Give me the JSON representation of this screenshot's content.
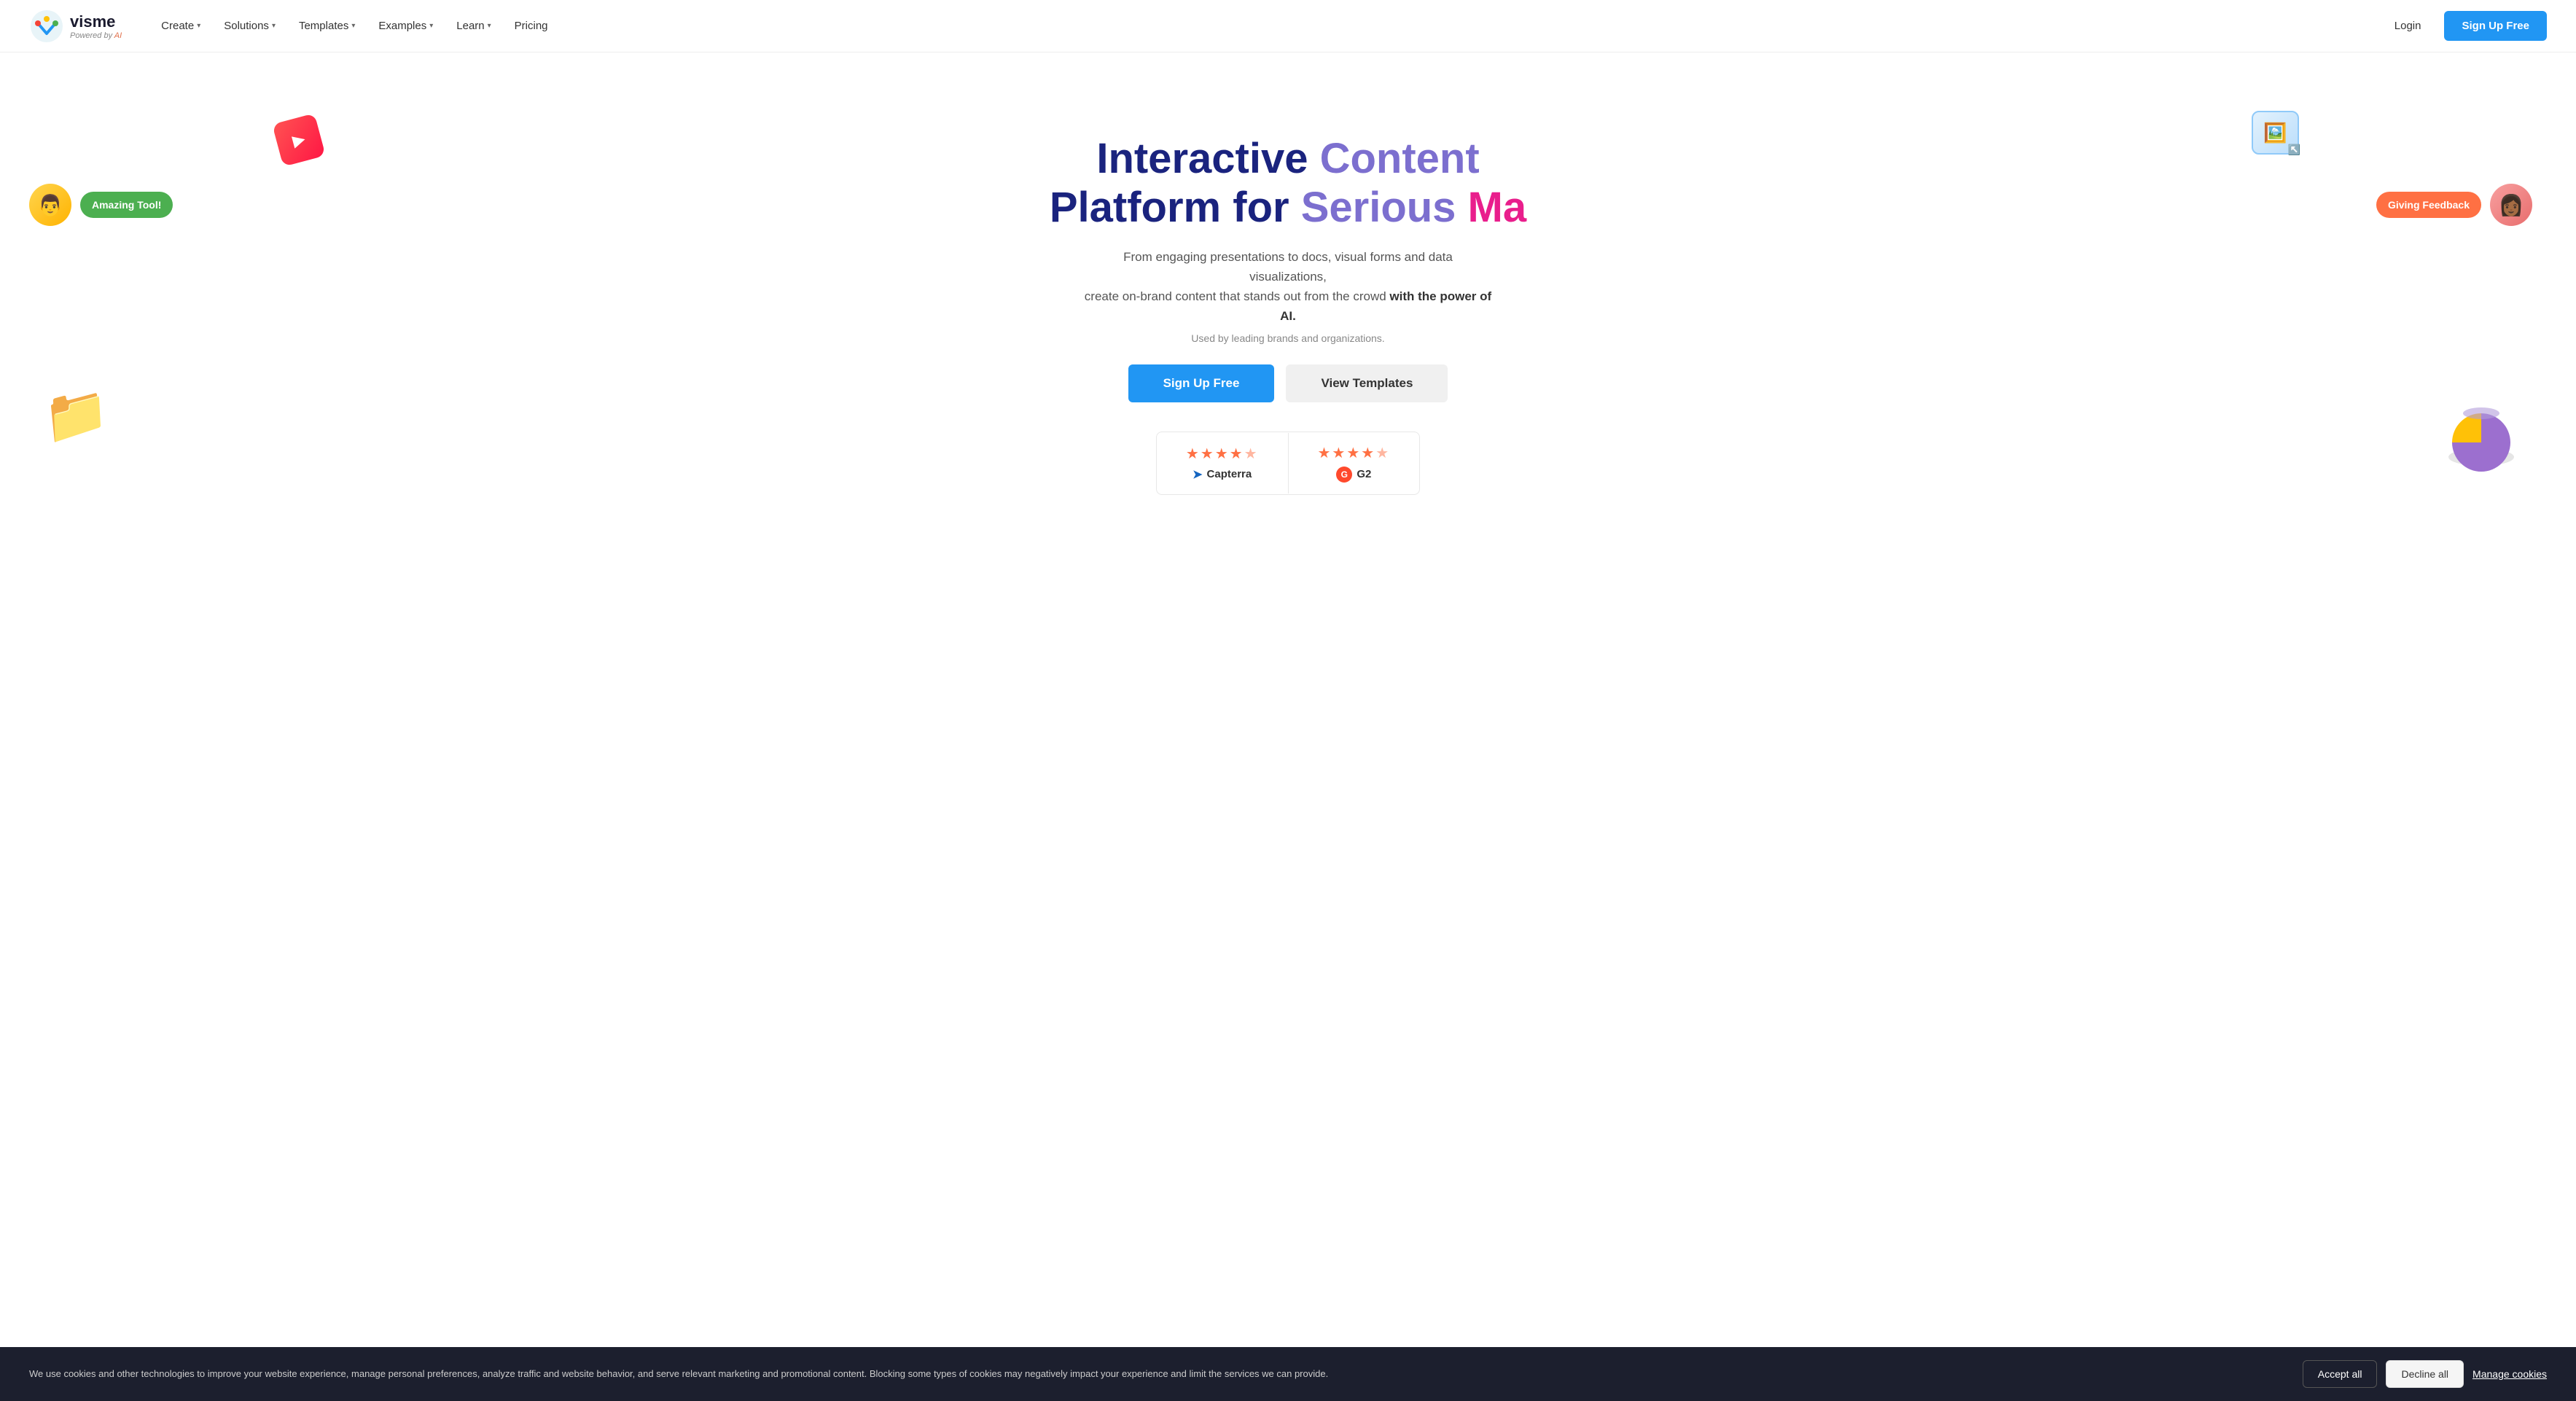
{
  "brand": {
    "name": "visme",
    "tagline": "Powered by AI",
    "tagline_highlight": "AI"
  },
  "nav": {
    "links": [
      {
        "label": "Create",
        "has_dropdown": true
      },
      {
        "label": "Solutions",
        "has_dropdown": true
      },
      {
        "label": "Templates",
        "has_dropdown": true
      },
      {
        "label": "Examples",
        "has_dropdown": true
      },
      {
        "label": "Learn",
        "has_dropdown": true
      },
      {
        "label": "Pricing",
        "has_dropdown": false
      }
    ],
    "login_label": "Login",
    "signup_label": "Sign Up Free"
  },
  "hero": {
    "title_line1": "Interactive Content",
    "title_line2_a": "Platform for Serious",
    "title_line2_b": "Ma",
    "subtitle1": "From engaging presentations to docs, visual forms and data visualizations,",
    "subtitle2": "create on-brand content that stands out from the crowd",
    "subtitle_bold": "with the power of AI.",
    "used_by": "Used by leading brands and organizations.",
    "cta_primary": "Sign Up Free",
    "cta_secondary": "View Templates"
  },
  "ratings": {
    "capterra": {
      "stars": "★★★★½",
      "label": "Capterra"
    },
    "g2": {
      "stars": "★★★★½",
      "label": "G2"
    }
  },
  "floats": {
    "amazing_tool": "Amazing Tool!",
    "giving_feedback": "Giving Feedback"
  },
  "cookie": {
    "text": "We use cookies and other technologies to improve your website experience, manage personal preferences, analyze traffic and website behavior, and serve relevant marketing and promotional content. Blocking some types of cookies may negatively impact your experience and limit the services we can provide.",
    "accept_all": "Accept all",
    "decline_all": "Decline all",
    "manage_cookies": "Manage cookies"
  }
}
